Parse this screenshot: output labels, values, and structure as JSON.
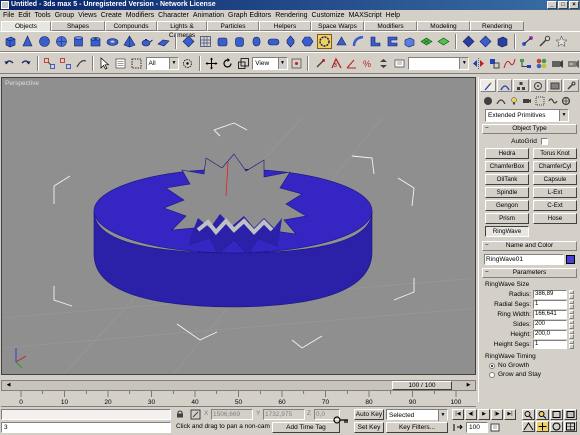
{
  "window": {
    "title": "Untitled   - 3ds max 5 - Unregistered Version - Network License"
  },
  "menu": [
    "File",
    "Edit",
    "Tools",
    "Group",
    "Views",
    "Create",
    "Modifiers",
    "Character",
    "Animation",
    "Graph Editors",
    "Rendering",
    "Customize",
    "MAXScript",
    "Help"
  ],
  "tabs": [
    {
      "label": "Objects",
      "active": true
    },
    {
      "label": "Shapes"
    },
    {
      "label": "Compounds"
    },
    {
      "label": "Lights & Cameras"
    },
    {
      "label": "Particles"
    },
    {
      "label": "Helpers"
    },
    {
      "label": "Space Warps"
    },
    {
      "label": "Modifiers"
    },
    {
      "label": "Modeling"
    },
    {
      "label": "Rendering"
    }
  ],
  "main_toolbar": {
    "selection_filter": "All",
    "ref_coord": "View",
    "named_selection": ""
  },
  "viewport": {
    "label": "Perspective"
  },
  "command_panel": {
    "category": "Extended Primitives",
    "object_type": {
      "title": "Object Type",
      "autogrid": "AutoGrid",
      "buttons": [
        "Hedra",
        "Torus Knot",
        "ChamferBox",
        "ChamferCyl",
        "OilTank",
        "Capsule",
        "Spindle",
        "L-Ext",
        "Gengon",
        "C-Ext",
        "Prism",
        "Hose",
        "RingWave"
      ]
    },
    "name_color": {
      "title": "Name and Color",
      "name": "RingWave01",
      "color": "#4a3fd8"
    },
    "parameters": {
      "title": "Parameters",
      "size_group": "RingWave Size",
      "fields": [
        {
          "label": "Radius:",
          "value": "386,89"
        },
        {
          "label": "Radial Segs:",
          "value": "1"
        },
        {
          "label": "Ring Width:",
          "value": "166,641"
        },
        {
          "label": "Sides:",
          "value": "200"
        },
        {
          "label": "Height:",
          "value": "200,0"
        },
        {
          "label": "Height Segs:",
          "value": "1"
        }
      ],
      "timing_group": "RingWave Timing",
      "timing_options": [
        {
          "label": "No Growth",
          "selected": true
        },
        {
          "label": "Grow and Stay",
          "selected": false
        }
      ]
    }
  },
  "timeline": {
    "frame_counter": "100 / 100",
    "ticks": [
      "0",
      "10",
      "20",
      "30",
      "40",
      "50",
      "60",
      "70",
      "80",
      "90",
      "100"
    ]
  },
  "status": {
    "listener_value": "3",
    "x_label": "X",
    "x_value": "1506,669",
    "y_label": "Y",
    "y_value": "1732,975",
    "z_label": "Z",
    "z_value": "0,0",
    "prompt": "Click and drag to pan a non-camera view",
    "add_time_tag": "Add Time Tag",
    "auto_key": "Auto Key",
    "set_key": "Set Key",
    "key_mode": "Selected",
    "key_filters": "Key Filters...",
    "current_frame": "100"
  },
  "colors": {
    "object": "#2b20a8",
    "object_top": "#3526c4",
    "viewport_bg": "#8f8f8f",
    "ui_face": "#d4d0c8"
  }
}
